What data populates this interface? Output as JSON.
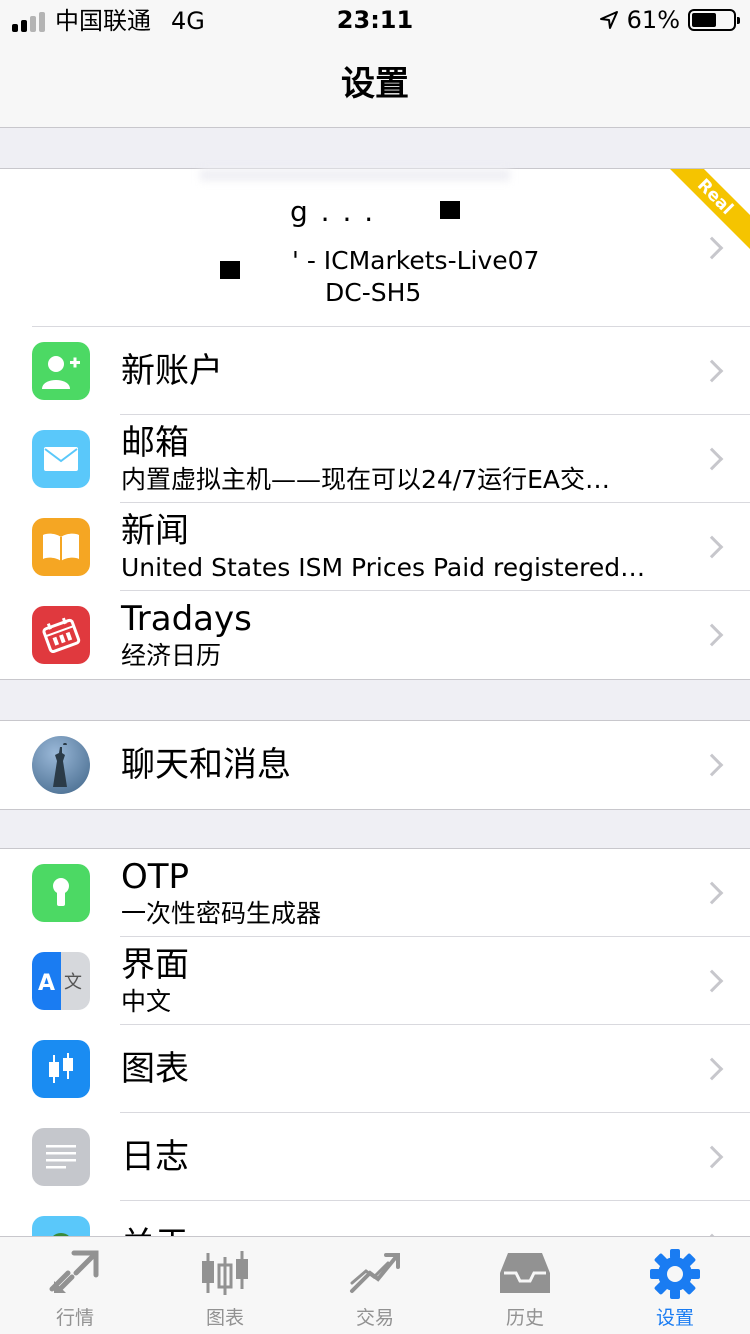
{
  "status_bar": {
    "carrier": "中国联通",
    "network": "4G",
    "time": "23:11",
    "battery": "61%"
  },
  "nav": {
    "title": "设置"
  },
  "account": {
    "line1": "g . . .",
    "line2": "' - ICMarkets-Live07",
    "line3": "DC-SH5",
    "badge": "Real"
  },
  "menu_group1": [
    {
      "title": "新账户",
      "subtitle": ""
    },
    {
      "title": "邮箱",
      "subtitle": "内置虚拟主机——现在可以24/7运行EA交…"
    },
    {
      "title": "新闻",
      "subtitle": "United States ISM Prices Paid registered…"
    },
    {
      "title": "Tradays",
      "subtitle": "经济日历"
    }
  ],
  "menu_group2": [
    {
      "title": "聊天和消息"
    }
  ],
  "menu_group3": [
    {
      "title": "OTP",
      "subtitle": "一次性密码生成器"
    },
    {
      "title": "界面",
      "subtitle": "中文"
    },
    {
      "title": "图表"
    },
    {
      "title": "日志"
    },
    {
      "title": "关于"
    }
  ],
  "tab_bar": [
    {
      "label": "行情"
    },
    {
      "label": "图表"
    },
    {
      "label": "交易"
    },
    {
      "label": "历史"
    },
    {
      "label": "设置"
    }
  ],
  "colors": {
    "accent": "#1a7cf2",
    "green": "#4cd964",
    "blue_light": "#5ac8fa",
    "orange": "#f5a623",
    "red": "#e0393e",
    "ribbon": "#f5c400"
  }
}
